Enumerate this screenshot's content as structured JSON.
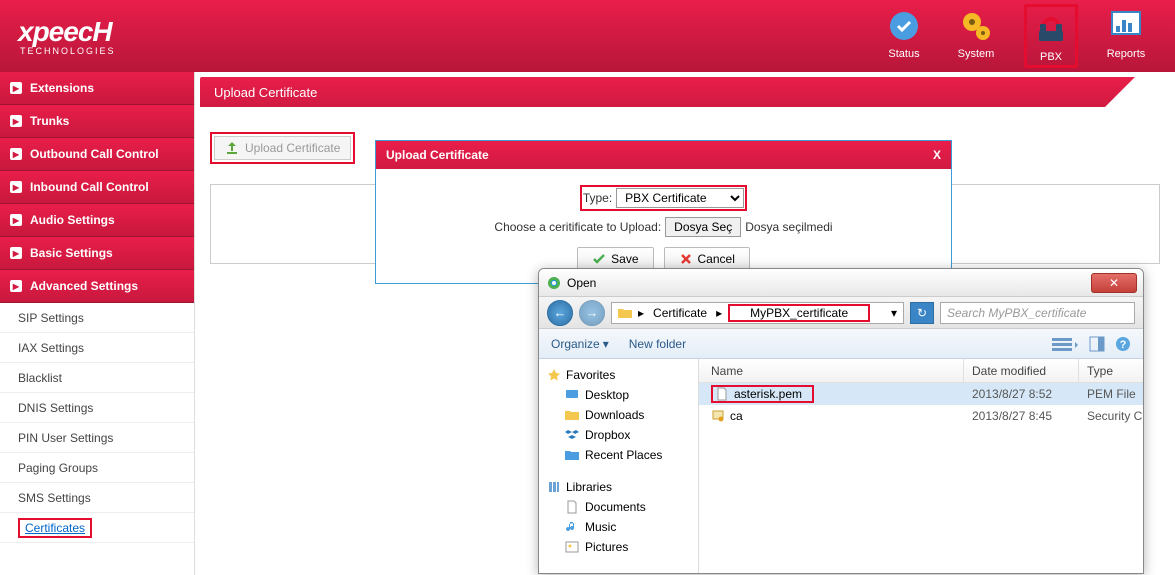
{
  "brand": {
    "name": "xpeecH",
    "sub": "TECHNOLOGIES"
  },
  "header_icons": {
    "status": "Status",
    "system": "System",
    "pbx": "PBX",
    "reports": "Reports"
  },
  "sidebar": {
    "items": [
      {
        "label": "Extensions"
      },
      {
        "label": "Trunks"
      },
      {
        "label": "Outbound Call Control"
      },
      {
        "label": "Inbound Call Control"
      },
      {
        "label": "Audio Settings"
      },
      {
        "label": "Basic Settings"
      },
      {
        "label": "Advanced Settings"
      }
    ],
    "sub_items": [
      {
        "label": "SIP Settings"
      },
      {
        "label": "IAX Settings"
      },
      {
        "label": "Blacklist"
      },
      {
        "label": "DNIS Settings"
      },
      {
        "label": "PIN User Settings"
      },
      {
        "label": "Paging Groups"
      },
      {
        "label": "SMS Settings"
      },
      {
        "label": "Certificates"
      }
    ]
  },
  "page": {
    "title": "Upload Certificate"
  },
  "upload_button": "Upload Certificate",
  "modal": {
    "title": "Upload Certificate",
    "close": "X",
    "type_label": "Type:",
    "type_value": "PBX Certificate",
    "choose_label": "Choose a ceritificate to Upload:",
    "file_btn": "Dosya Seç",
    "file_status": "Dosya seçilmedi",
    "save": "Save",
    "cancel": "Cancel"
  },
  "file_dialog": {
    "title": "Open",
    "path": {
      "seg1": "Certificate",
      "seg2": "MyPBX_certificate"
    },
    "search_placeholder": "Search MyPBX_certificate",
    "toolbar": {
      "organize": "Organize",
      "new_folder": "New folder"
    },
    "tree": {
      "favorites": "Favorites",
      "desktop": "Desktop",
      "downloads": "Downloads",
      "dropbox": "Dropbox",
      "recent": "Recent Places",
      "libraries": "Libraries",
      "documents": "Documents",
      "music": "Music",
      "pictures": "Pictures"
    },
    "columns": {
      "name": "Name",
      "date": "Date modified",
      "type": "Type"
    },
    "rows": [
      {
        "name": "asterisk.pem",
        "date": "2013/8/27 8:52",
        "type": "PEM File"
      },
      {
        "name": "ca",
        "date": "2013/8/27 8:45",
        "type": "Security C"
      }
    ]
  }
}
